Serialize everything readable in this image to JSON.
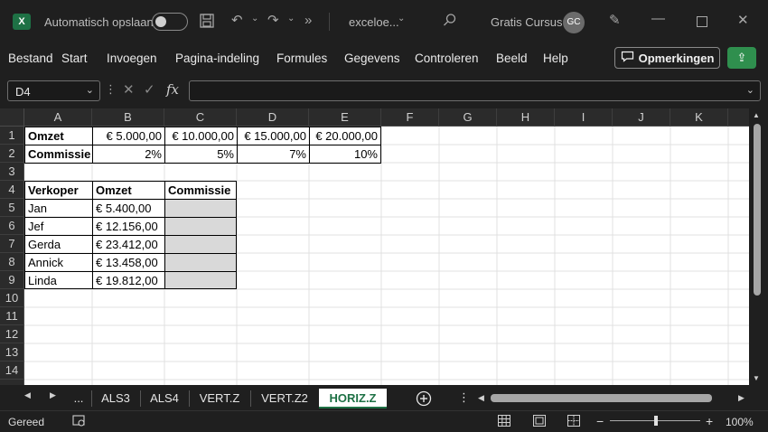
{
  "titlebar": {
    "app_icon_letter": "X",
    "autosave_label": "Automatisch opslaan",
    "filename": "exceloe...",
    "user_name": "Gratis Cursus",
    "user_initials": "GC"
  },
  "menu": {
    "items": [
      "Bestand",
      "Start",
      "Invoegen",
      "Pagina-indeling",
      "Formules",
      "Gegevens",
      "Controleren",
      "Beeld",
      "Help"
    ],
    "comments_label": "Opmerkingen"
  },
  "formula_bar": {
    "name_box": "D4",
    "fx_label": "fx",
    "formula": ""
  },
  "grid": {
    "columns": [
      "A",
      "B",
      "C",
      "D",
      "E",
      "F",
      "G",
      "H",
      "I",
      "J",
      "K"
    ],
    "rows": [
      "1",
      "2",
      "3",
      "4",
      "5",
      "6",
      "7",
      "8",
      "9",
      "10",
      "11",
      "12",
      "13",
      "14"
    ],
    "row1": [
      "Omzet",
      "€   5.000,00",
      "€ 10.000,00",
      "€ 15.000,00",
      "€ 20.000,00"
    ],
    "row2": [
      "Commissie",
      "2%",
      "5%",
      "7%",
      "10%"
    ],
    "row4": [
      "Verkoper",
      "Omzet",
      "Commissie"
    ],
    "sellers": [
      {
        "name": "Jan",
        "omzet": "€    5.400,00"
      },
      {
        "name": "Jef",
        "omzet": "€ 12.156,00"
      },
      {
        "name": "Gerda",
        "omzet": "€ 23.412,00"
      },
      {
        "name": "Annick",
        "omzet": "€ 13.458,00"
      },
      {
        "name": "Linda",
        "omzet": "€ 19.812,00"
      }
    ]
  },
  "sheets": {
    "more_label": "...",
    "tabs": [
      "ALS3",
      "ALS4",
      "VERT.Z",
      "VERT.Z2",
      "HORIZ.Z"
    ],
    "active": "HORIZ.Z"
  },
  "status": {
    "ready": "Gereed",
    "zoom": "100%"
  },
  "colors": {
    "accent": "#1e7145",
    "share_button": "#2f8f4e",
    "input_cell_fill": "#d9d9d9"
  }
}
